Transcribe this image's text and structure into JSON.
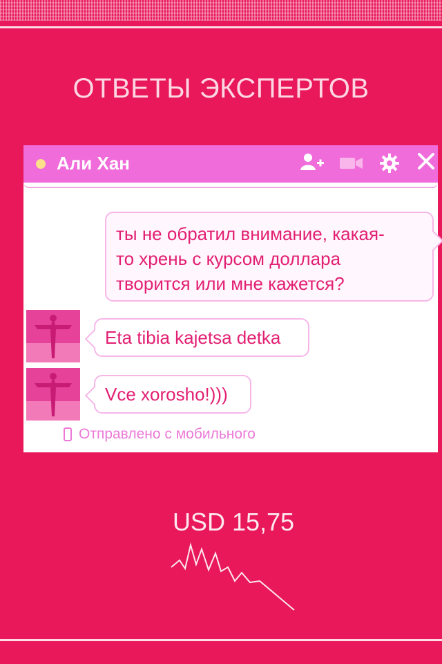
{
  "page": {
    "title": "ОТВЕТЫ ЭКСПЕРТОВ",
    "background_color": "#e8185a"
  },
  "chat": {
    "contact_name": "Али Хан",
    "status": "online",
    "header_icons": [
      "add-user-icon",
      "video-icon",
      "gear-icon",
      "close-icon"
    ],
    "messages": [
      {
        "direction": "outgoing",
        "text_lines": [
          "ты не обратил внимание, какая-",
          "то хрень с курсом доллара",
          "творится или мне кажется?"
        ]
      },
      {
        "direction": "incoming",
        "text": "Eta tibia kajetsa detka"
      },
      {
        "direction": "incoming",
        "text": "Vce xorosho!)))"
      }
    ],
    "footer_note": "Отправлено с мобильного"
  },
  "currency": {
    "label": "USD 15,75",
    "trend": "down"
  }
}
